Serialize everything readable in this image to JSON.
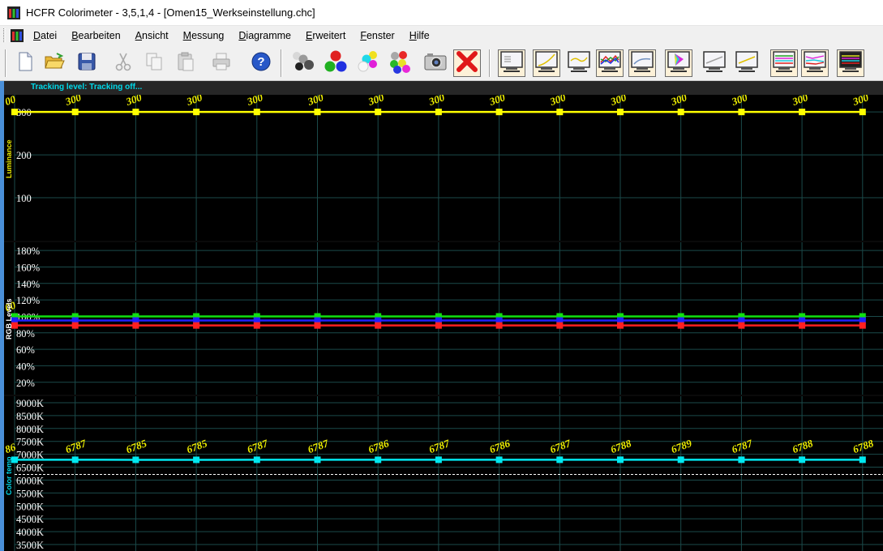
{
  "window": {
    "title": "HCFR Colorimeter - 3,5,1,4 - [Omen15_Werkseinstellung.chc]"
  },
  "menu": {
    "items": [
      {
        "key": "datei",
        "label": "Datei"
      },
      {
        "key": "bearbeiten",
        "label": "Bearbeiten"
      },
      {
        "key": "ansicht",
        "label": "Ansicht"
      },
      {
        "key": "messung",
        "label": "Messung"
      },
      {
        "key": "diagramme",
        "label": "Diagramme"
      },
      {
        "key": "erweitert",
        "label": "Erweitert"
      },
      {
        "key": "fenster",
        "label": "Fenster"
      },
      {
        "key": "hilfe",
        "label": "Hilfe"
      }
    ]
  },
  "toolbar": {
    "buttons": [
      {
        "key": "new",
        "icon": "new-document-icon",
        "enabled": true
      },
      {
        "key": "open",
        "icon": "open-folder-icon",
        "enabled": true
      },
      {
        "key": "save",
        "icon": "save-disk-icon",
        "enabled": true
      },
      {
        "key": "cut",
        "icon": "cut-icon",
        "enabled": false
      },
      {
        "key": "copy",
        "icon": "copy-icon",
        "enabled": false
      },
      {
        "key": "paste",
        "icon": "paste-icon",
        "enabled": false
      },
      {
        "key": "print",
        "icon": "print-icon",
        "enabled": false
      },
      {
        "key": "help",
        "icon": "help-icon",
        "enabled": true
      },
      {
        "key": "measure-gray",
        "icon": "gray-spheres-icon",
        "enabled": true
      },
      {
        "key": "measure-primaries",
        "icon": "rgb-spheres-icon",
        "enabled": true
      },
      {
        "key": "measure-secondaries",
        "icon": "secondary-spheres-icon",
        "enabled": true
      },
      {
        "key": "measure-all",
        "icon": "all-spheres-icon",
        "enabled": true
      },
      {
        "key": "camera",
        "icon": "camera-icon",
        "enabled": true
      },
      {
        "key": "stop",
        "icon": "stop-cross-icon",
        "enabled": true
      },
      {
        "key": "view-measures",
        "icon": "monitor-data-icon",
        "enabled": true
      },
      {
        "key": "view-gamma",
        "icon": "monitor-gamma-icon",
        "enabled": true
      },
      {
        "key": "view-luminance",
        "icon": "monitor-luminance-icon",
        "enabled": true
      },
      {
        "key": "view-rgb",
        "icon": "monitor-rgb-icon",
        "enabled": true
      },
      {
        "key": "view-near-black",
        "icon": "monitor-near-black-icon",
        "enabled": true
      },
      {
        "key": "view-cie",
        "icon": "monitor-cie-icon",
        "enabled": true
      },
      {
        "key": "view-colortemp",
        "icon": "monitor-colortemp-icon",
        "enabled": true
      },
      {
        "key": "view-saturation",
        "icon": "monitor-saturation-icon",
        "enabled": true
      },
      {
        "key": "view-multi-1",
        "icon": "monitor-multi-lines-icon",
        "enabled": true
      },
      {
        "key": "view-multi-2",
        "icon": "monitor-multi-lines-2-icon",
        "enabled": true
      },
      {
        "key": "view-multi-3",
        "icon": "monitor-multi-lines-3-icon",
        "enabled": true
      }
    ]
  },
  "status": {
    "tracking": "Tracking level: Tracking off..."
  },
  "colors": {
    "luminance": "#ffff00",
    "red": "#ff2020",
    "green": "#10e010",
    "blue": "#2020ff",
    "colortemp": "#00e8f0",
    "grid": "#1b4a4a",
    "axis_label": "#ffffff",
    "value_label": "#f0f000",
    "background": "#000000"
  },
  "chart_data": [
    {
      "type": "line",
      "key": "luminance",
      "title": "",
      "ylabel": "Luminance",
      "yticks": [
        "100",
        "200",
        "300"
      ],
      "ytick_values": [
        100,
        200,
        300
      ],
      "ylim": [
        0,
        340
      ],
      "series": [
        {
          "name": "",
          "values": [
            300,
            300,
            300,
            300,
            300,
            300,
            300,
            300,
            300,
            300,
            300,
            300,
            300,
            300,
            300
          ],
          "labels": [
            "00",
            "300",
            "300",
            "300",
            "300",
            "300",
            "300",
            "300",
            "300",
            "300",
            "300",
            "300",
            "300",
            "300",
            "300"
          ]
        }
      ]
    },
    {
      "type": "line",
      "key": "rgb",
      "title": "",
      "ylabel": "RGB Levels",
      "yticks": [
        "20%",
        "40%",
        "60%",
        "80%",
        "100%",
        "120%",
        "140%",
        "160%",
        "180%"
      ],
      "ytick_values": [
        20,
        40,
        60,
        80,
        100,
        120,
        140,
        160,
        180
      ],
      "ylim": [
        5,
        190
      ],
      "series": [
        {
          "name": "",
          "color_key": "green",
          "values": [
            100,
            100,
            100,
            100,
            100,
            100,
            100,
            100,
            100,
            100,
            100,
            100,
            100,
            100,
            100
          ]
        },
        {
          "name": "",
          "color_key": "blue",
          "values": [
            95,
            95,
            95,
            95,
            95,
            95,
            95,
            95,
            95,
            95,
            95,
            95,
            95,
            95,
            95
          ]
        },
        {
          "name": "",
          "color_key": "red",
          "values": [
            89,
            89,
            89,
            89,
            89,
            89,
            89,
            89,
            89,
            89,
            89,
            89,
            89,
            89,
            89
          ]
        }
      ],
      "first_label": "00"
    },
    {
      "type": "line",
      "key": "colortemp",
      "title": "",
      "ylabel": "Color temp",
      "yticks": [
        "3500K",
        "4000K",
        "4500K",
        "5000K",
        "5500K",
        "6000K",
        "6500K",
        "7000K",
        "7500K",
        "8000K",
        "8500K",
        "9000K"
      ],
      "ytick_values": [
        3500,
        4000,
        4500,
        5000,
        5500,
        6000,
        6500,
        7000,
        7500,
        8000,
        8500,
        9000
      ],
      "ylim": [
        3250,
        9250
      ],
      "reference": 6500,
      "series": [
        {
          "name": "",
          "values": [
            6786,
            6787,
            6785,
            6785,
            6787,
            6787,
            6786,
            6787,
            6786,
            6787,
            6788,
            6789,
            6787,
            6788,
            6788
          ],
          "labels": [
            "86",
            "6787",
            "6785",
            "6785",
            "6787",
            "6787",
            "6786",
            "6787",
            "6786",
            "6787",
            "6788",
            "6789",
            "6787",
            "6788",
            "6788"
          ]
        }
      ]
    }
  ]
}
